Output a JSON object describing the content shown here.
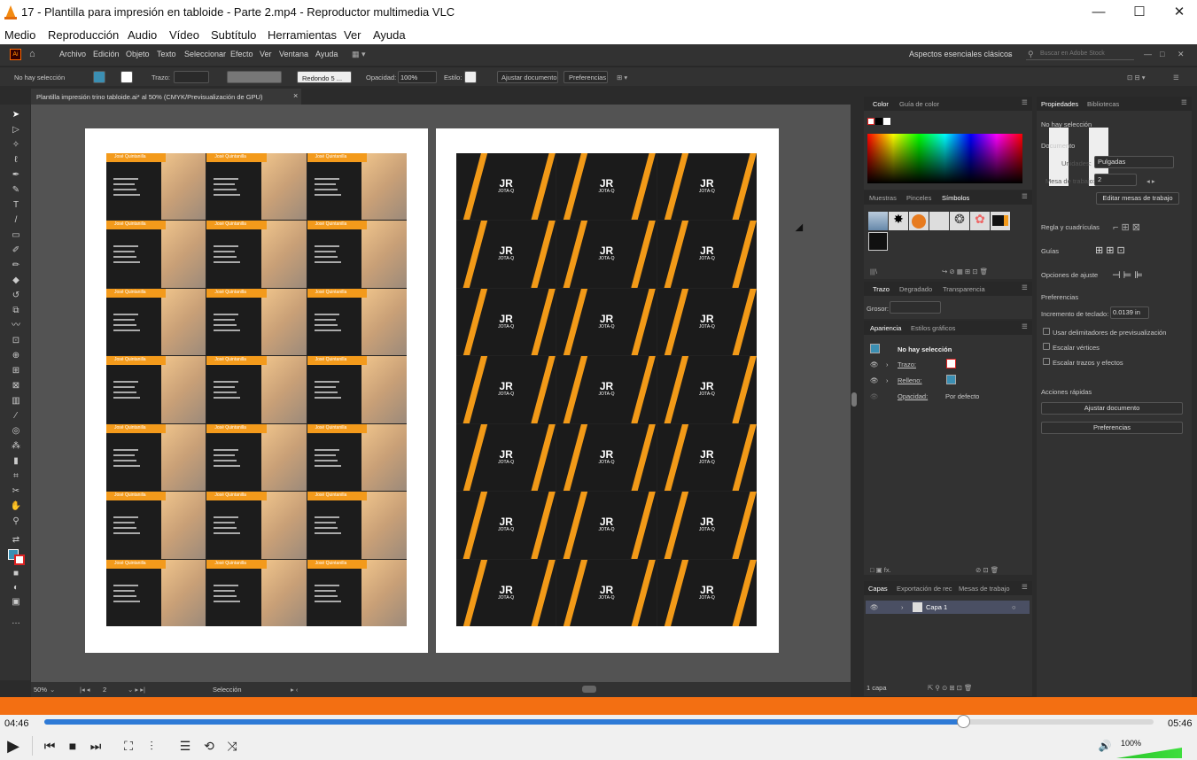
{
  "window": {
    "title": "17 - Plantilla para impresión en tabloide - Parte 2.mp4 - Reproductor multimedia VLC"
  },
  "vlc_menu": [
    "Medio",
    "Reproducción",
    "Audio",
    "Vídeo",
    "Subtítulo",
    "Herramientas",
    "Ver",
    "Ayuda"
  ],
  "ai_menu": {
    "logo": "Ai",
    "items": [
      "Archivo",
      "Edición",
      "Objeto",
      "Texto",
      "Seleccionar",
      "Efecto",
      "Ver",
      "Ventana",
      "Ayuda"
    ],
    "workspace": "Aspectos esenciales clásicos",
    "search_placeholder": "Buscar en Adobe Stock"
  },
  "control_bar": {
    "selection": "No hay selección",
    "stroke_label": "Trazo:",
    "brush": "Redondo 5 ...",
    "opacity_label": "Opacidad:",
    "opacity": "100%",
    "style_label": "Estilo:",
    "fit_doc": "Ajustar documento",
    "prefs": "Preferencias"
  },
  "doc_tab": {
    "label": "Plantilla impresión trino tabloide.ai* al 50% (CMYK/Previsualización de GPU)",
    "close": "×"
  },
  "cards": {
    "front_name": "José Quintanilla",
    "back_logo": "JR",
    "back_text": "JOTA-Q"
  },
  "statusbar": {
    "zoom": "50%",
    "artboard": "2",
    "tool": "Selección"
  },
  "color_panel": {
    "tabs": [
      "Color",
      "Guía de color"
    ]
  },
  "swatch_panel": {
    "tabs": [
      "Muestras",
      "Pinceles",
      "Símbolos"
    ]
  },
  "stroke_panel": {
    "tabs": [
      "Trazo",
      "Degradado",
      "Transparencia"
    ],
    "weight_label": "Grosor:"
  },
  "appearance_panel": {
    "tabs": [
      "Apariencia",
      "Estilos gráficos"
    ],
    "title": "No hay selección",
    "rows": [
      {
        "label": "Trazo:"
      },
      {
        "label": "Relleno:"
      },
      {
        "label": "Opacidad:",
        "value": "Por defecto"
      }
    ]
  },
  "layers_panel": {
    "tabs": [
      "Capas",
      "Exportación de rec",
      "Mesas de trabajo"
    ],
    "layer": "Capa 1",
    "count": "1 capa"
  },
  "properties": {
    "tabs": [
      "Propiedades",
      "Bibliotecas"
    ],
    "no_selection": "No hay selección",
    "document": "Documento",
    "units_label": "Unidades:",
    "units": "Pulgadas",
    "artboard_label": "Mesa de trabajo:",
    "artboard_value": "2",
    "edit_artboards": "Editar mesas de trabajo",
    "rulers": "Regla y cuadrículas",
    "guides": "Guías",
    "snap": "Opciones de ajuste",
    "prefs_title": "Preferencias",
    "key_inc_label": "Incremento de teclado:",
    "key_inc": "0.0139 in",
    "checks": [
      "Usar delimitadores de previsualización",
      "Escalar vértices",
      "Escalar trazos y efectos"
    ],
    "quick": "Acciones rápidas",
    "fit_doc": "Ajustar documento",
    "prefs_btn": "Preferencias"
  },
  "player": {
    "elapsed": "04:46",
    "total": "05:46",
    "progress": 0.828,
    "volume": "100%",
    "volume_level": 1.0
  },
  "colors": {
    "accent": "#f36f12",
    "seek": "#2e7ad6",
    "card_orange": "#f39a1b"
  }
}
